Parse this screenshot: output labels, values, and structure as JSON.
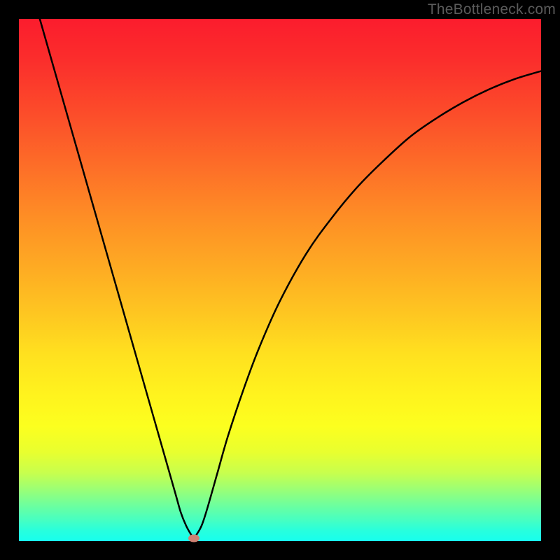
{
  "watermark": "TheBottleneck.com",
  "chart_data": {
    "type": "line",
    "title": "",
    "xlabel": "",
    "ylabel": "",
    "xlim": [
      0,
      100
    ],
    "ylim": [
      0,
      100
    ],
    "grid": false,
    "series": [
      {
        "name": "bottleneck-curve",
        "x": [
          4,
          6,
          8,
          10,
          12,
          14,
          16,
          18,
          20,
          22,
          24,
          26,
          28,
          30,
          31,
          32,
          33,
          33.5,
          34,
          35,
          36,
          38,
          40,
          43,
          46,
          50,
          55,
          60,
          65,
          70,
          75,
          80,
          85,
          90,
          95,
          100
        ],
        "y": [
          100,
          93,
          86,
          79,
          72,
          65,
          58,
          51,
          44,
          37,
          30,
          23,
          16,
          9,
          5.5,
          3,
          1.2,
          0.6,
          1.2,
          3,
          6,
          13,
          20,
          29,
          37,
          46,
          55,
          62,
          68,
          73,
          77.5,
          81,
          84,
          86.5,
          88.5,
          90
        ]
      }
    ],
    "marker": {
      "x": 33.5,
      "y": 0.6,
      "color": "#cf8173"
    },
    "gradient_stops": [
      {
        "pos": 0,
        "color": "#fb1c2d"
      },
      {
        "pos": 18,
        "color": "#fc4c2a"
      },
      {
        "pos": 38,
        "color": "#fe8e25"
      },
      {
        "pos": 57,
        "color": "#fec821"
      },
      {
        "pos": 72,
        "color": "#fff31e"
      },
      {
        "pos": 87,
        "color": "#c7ff4e"
      },
      {
        "pos": 100,
        "color": "#17ffee"
      }
    ]
  }
}
